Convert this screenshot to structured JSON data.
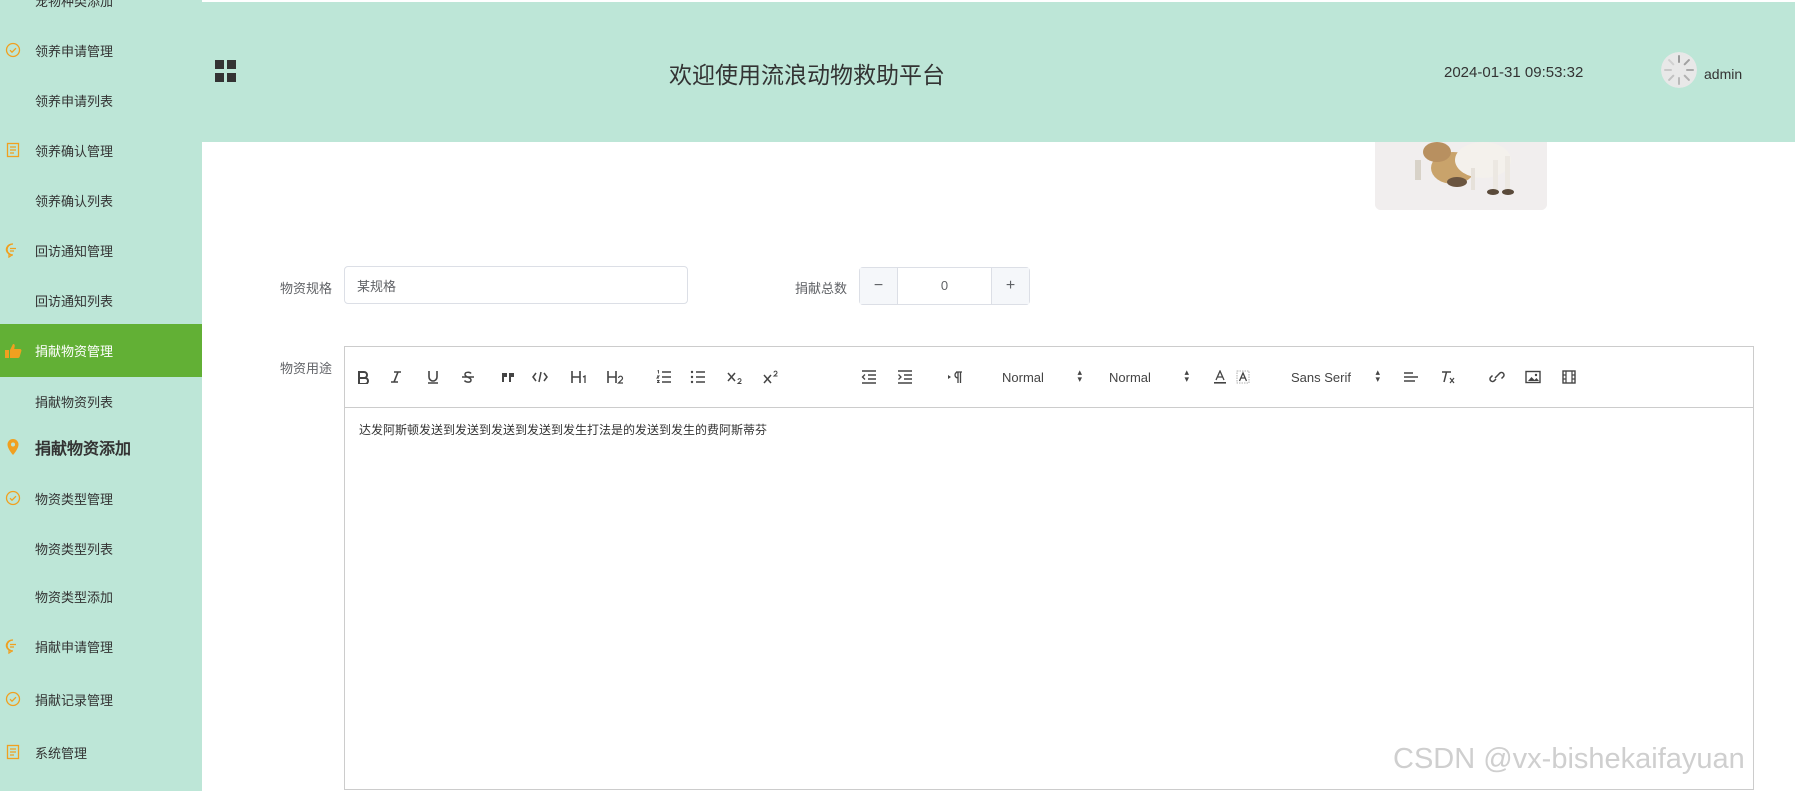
{
  "sidebar": {
    "items": [
      {
        "label": "宠物种类添加",
        "icon": "none"
      },
      {
        "label": "领养申请管理",
        "icon": "check-circle-icon"
      },
      {
        "label": "领养申请列表",
        "icon": "none"
      },
      {
        "label": "领养确认管理",
        "icon": "document-icon"
      },
      {
        "label": "领养确认列表",
        "icon": "none"
      },
      {
        "label": "回访通知管理",
        "icon": "chat-icon"
      },
      {
        "label": "回访通知列表",
        "icon": "none"
      },
      {
        "label": "捐献物资管理",
        "icon": "thumbs-up-icon"
      },
      {
        "label": "捐献物资列表",
        "icon": "none"
      },
      {
        "label": "捐献物资添加",
        "icon": "location-pin-icon"
      },
      {
        "label": "物资类型管理",
        "icon": "check-circle-icon"
      },
      {
        "label": "物资类型列表",
        "icon": "none"
      },
      {
        "label": "物资类型添加",
        "icon": "none"
      },
      {
        "label": "捐献申请管理",
        "icon": "chat-icon"
      },
      {
        "label": "捐献记录管理",
        "icon": "check-circle-icon"
      },
      {
        "label": "系统管理",
        "icon": "document-icon"
      }
    ],
    "active_index": 7,
    "icon_color": "#f0a020",
    "active_color": "#62b035"
  },
  "header": {
    "title": "欢迎使用流浪动物救助平台",
    "datetime": "2024-01-31 09:53:32",
    "username": "admin",
    "background": "#bde6d7"
  },
  "form": {
    "spec_label": "物资规格",
    "spec_value": "某规格",
    "total_label": "捐献总数",
    "total_value": "0",
    "minus": "−",
    "plus": "+",
    "usage_label": "物资用途"
  },
  "editor": {
    "header_select": "Normal",
    "size_select": "Normal",
    "font_select": "Sans Serif",
    "content": "达发阿斯顿发送到发送到发送到发送到发生打法是的发送到发生的费阿斯蒂芬"
  },
  "watermark": "CSDN @vx-bishekaifayuan"
}
